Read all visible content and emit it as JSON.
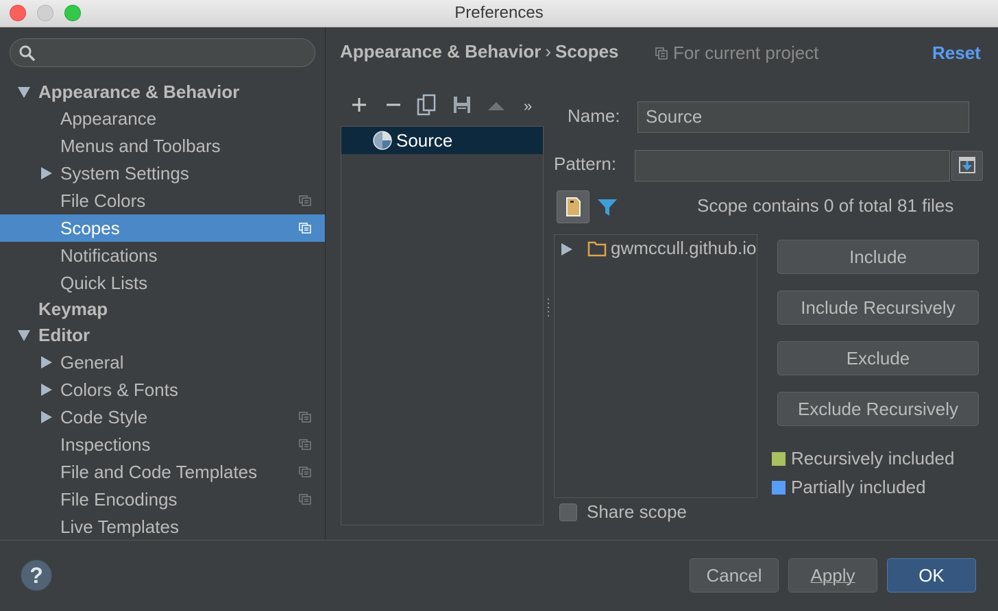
{
  "window": {
    "title": "Preferences"
  },
  "search": {
    "placeholder": ""
  },
  "sidebar": {
    "items": [
      {
        "label": "Appearance & Behavior"
      },
      {
        "label": "Appearance"
      },
      {
        "label": "Menus and Toolbars"
      },
      {
        "label": "System Settings"
      },
      {
        "label": "File Colors"
      },
      {
        "label": "Scopes"
      },
      {
        "label": "Notifications"
      },
      {
        "label": "Quick Lists"
      },
      {
        "label": "Keymap"
      },
      {
        "label": "Editor"
      },
      {
        "label": "General"
      },
      {
        "label": "Colors & Fonts"
      },
      {
        "label": "Code Style"
      },
      {
        "label": "Inspections"
      },
      {
        "label": "File and Code Templates"
      },
      {
        "label": "File Encodings"
      },
      {
        "label": "Live Templates"
      }
    ]
  },
  "header": {
    "breadcrumb": [
      "Appearance & Behavior",
      "Scopes"
    ],
    "separator": "›",
    "scope_note": "For current project",
    "reset_label": "Reset"
  },
  "toolbar": {
    "add": "+",
    "remove": "−",
    "more": "»"
  },
  "scopes": {
    "items": [
      {
        "label": "Source"
      }
    ]
  },
  "form": {
    "name_label": "Name:",
    "name_value": "Source",
    "pattern_label": "Pattern:",
    "pattern_value": "",
    "scope_contains": "Scope contains 0 of total 81 files"
  },
  "file_tree": {
    "root_label": "gwmccull.github.io"
  },
  "actions": {
    "include": "Include",
    "include_recursively": "Include Recursively",
    "exclude": "Exclude",
    "exclude_recursively": "Exclude Recursively"
  },
  "legend": {
    "recursively_included": {
      "label": "Recursively included",
      "color": "#a9c15e"
    },
    "partially_included": {
      "label": "Partially included",
      "color": "#589df6"
    }
  },
  "share_scope": {
    "label": "Share scope",
    "checked": false
  },
  "dialog": {
    "help": "?",
    "cancel": "Cancel",
    "apply": "Apply",
    "ok": "OK"
  },
  "colors": {
    "selection": "#4a88c7",
    "list_selection": "#0d293e",
    "link": "#589df6"
  }
}
